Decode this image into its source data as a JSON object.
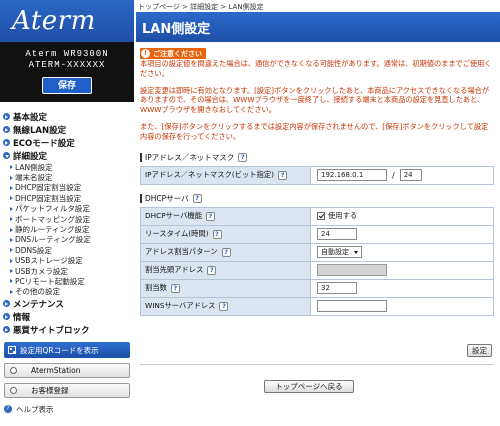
{
  "sidebar": {
    "logo": "Aterm",
    "model_line1": "Aterm WR9300N",
    "model_line2": "ATERM-XXXXXX",
    "save_label": "保存",
    "menu": [
      {
        "label": "基本設定"
      },
      {
        "label": "無線LAN設定"
      },
      {
        "label": "ECOモード設定"
      },
      {
        "label": "詳細設定"
      }
    ],
    "submenu": [
      {
        "label": "LAN側設定"
      },
      {
        "label": "端末名設定"
      },
      {
        "label": "DHCP固定割当設定"
      },
      {
        "label": "DHCP固定割当設定"
      },
      {
        "label": "パケットフィルタ設定"
      },
      {
        "label": "ポートマッピング設定"
      },
      {
        "label": "静的ルーティング設定"
      },
      {
        "label": "DNSルーティング設定"
      },
      {
        "label": "DDNS設定"
      },
      {
        "label": "USBストレージ設定"
      },
      {
        "label": "USBカメラ設定"
      },
      {
        "label": "PCリモート起動設定"
      },
      {
        "label": "その他の設定"
      }
    ],
    "menu2": [
      {
        "label": "メンテナンス"
      },
      {
        "label": "情報"
      },
      {
        "label": "悪質サイトブロック"
      }
    ],
    "qr_button": "設定用QRコードを表示",
    "aterm_station": "AtermStation",
    "register": "お客様登録",
    "help": "ヘルプ表示"
  },
  "main": {
    "breadcrumb": "トップページ > 詳細設定 > LAN側設定",
    "title": "LAN側設定",
    "warning_badge": "ご注意ください",
    "warning_1": "本項目の設定値を間違えた場合は、通信ができなくなる可能性があります。通常は、初期値のままでご使用ください。",
    "warning_2": "設定変更は即時に有効となります。[設定]ボタンをクリックしたあと、本商品にアクセスできなくなる場合がありますので、その場合は、WWWブラウザを一度終了し、接続する端末と本商品の設定を見直したあと、WWWブラウザを開きなおしてください。",
    "warning_3": "また、[保存]ボタンをクリックするまでは設定内容が保存されませんので、[保存]ボタンをクリックして設定内容の保存を行ってください。",
    "ip_section": {
      "title": "IPアドレス／ネットマスク",
      "row_label": "IPアドレス／ネットマスク(ビット指定)",
      "ip_value": "192.168.0.1",
      "mask_value": "24"
    },
    "dhcp_section": {
      "title": "DHCPサーバ",
      "rows": {
        "function_label": "DHCPサーバ機能",
        "function_value": "使用する",
        "lease_label": "リースタイム(時間)",
        "lease_value": "24",
        "pattern_label": "アドレス割当パターン",
        "pattern_value": "自動設定",
        "start_label": "割当先頭アドレス",
        "start_value": "",
        "count_label": "割当数",
        "count_value": "32",
        "wins_label": "WINSサーバアドレス",
        "wins_value": ""
      }
    },
    "set_button": "設定",
    "back_button": "トップページへ戻る",
    "help_glyph": "?"
  },
  "colors": {
    "accent_blue": "#2a67c4",
    "warning_orange": "#e8630a",
    "warning_text": "#c83200",
    "label_bg": "#dbe4f1"
  }
}
